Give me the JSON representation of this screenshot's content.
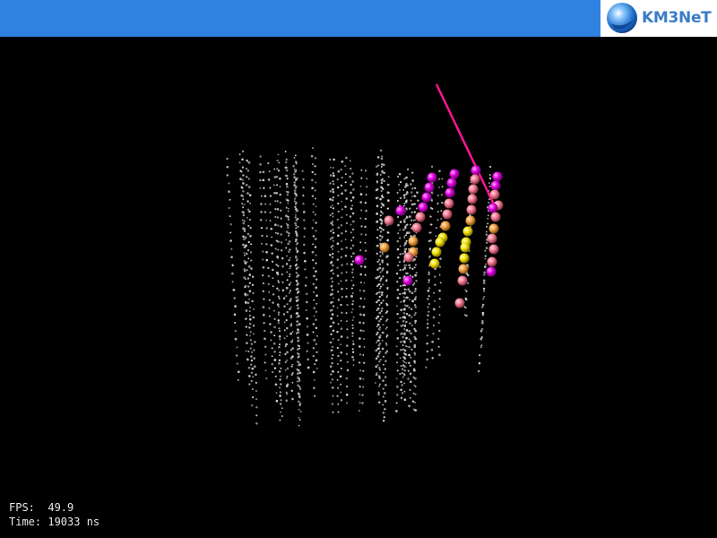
{
  "header": {
    "logo_text": "KM3NeT",
    "bar_color": "#2f82e0"
  },
  "viewer": {
    "track_color": "#ff1493",
    "hit_colors": [
      "#ff00ff",
      "#ff80a0",
      "#ffa060",
      "#ffd000",
      "#ffff00"
    ],
    "detector_dot_color": "#dcdcdc"
  },
  "stats": {
    "fps_label": "FPS:",
    "fps_value": "49.9",
    "time_label": "Time:",
    "time_value": "19033 ns"
  }
}
